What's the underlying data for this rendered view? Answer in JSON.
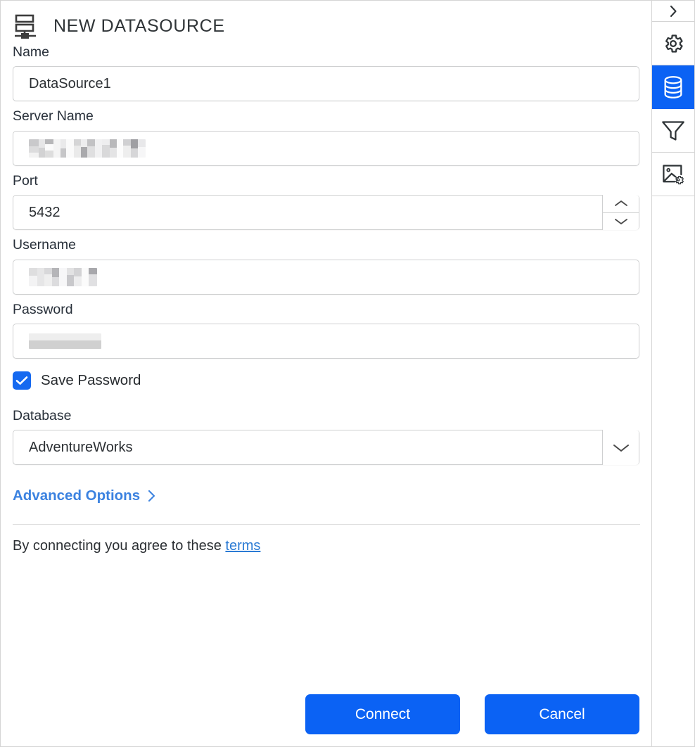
{
  "header": {
    "title": "NEW DATASOURCE",
    "icon": "datasource-server-icon"
  },
  "form": {
    "name": {
      "label": "Name",
      "value": "DataSource1",
      "placeholder": ""
    },
    "server_name": {
      "label": "Server Name",
      "value": "",
      "placeholder": "",
      "redacted": true
    },
    "port": {
      "label": "Port",
      "value": "5432",
      "placeholder": "",
      "spinner_up_icon": "chevron-up-icon",
      "spinner_down_icon": "chevron-down-icon"
    },
    "username": {
      "label": "Username",
      "value": "",
      "placeholder": "",
      "redacted": true
    },
    "password": {
      "label": "Password",
      "value": "",
      "placeholder": "",
      "redacted": true
    },
    "save_password": {
      "label": "Save Password",
      "checked": true,
      "check_icon": "checkmark-icon"
    },
    "database": {
      "label": "Database",
      "value": "AdventureWorks",
      "placeholder": "",
      "dropdown_icon": "chevron-down-icon",
      "options": [
        "AdventureWorks"
      ]
    }
  },
  "advanced_options": {
    "label": "Advanced Options",
    "icon": "chevron-right-icon"
  },
  "terms": {
    "text": "By connecting you agree to these ",
    "link_label": "terms"
  },
  "actions": {
    "connect_label": "Connect",
    "cancel_label": "Cancel"
  },
  "sidebar": {
    "items": [
      {
        "name": "expand-panel",
        "icon": "chevron-right-icon",
        "active": false
      },
      {
        "name": "settings",
        "icon": "gear-icon",
        "active": false
      },
      {
        "name": "datasource",
        "icon": "database-icon",
        "active": true
      },
      {
        "name": "filter",
        "icon": "funnel-icon",
        "active": false
      },
      {
        "name": "image-settings",
        "icon": "image-gear-icon",
        "active": false
      }
    ]
  },
  "colors": {
    "accent_blue": "#0b62f4",
    "link_blue": "#3b82e0",
    "terms_link_blue": "#2a7ad4",
    "border_grey": "#cfd0d1",
    "text_dark": "#2b2f33"
  }
}
